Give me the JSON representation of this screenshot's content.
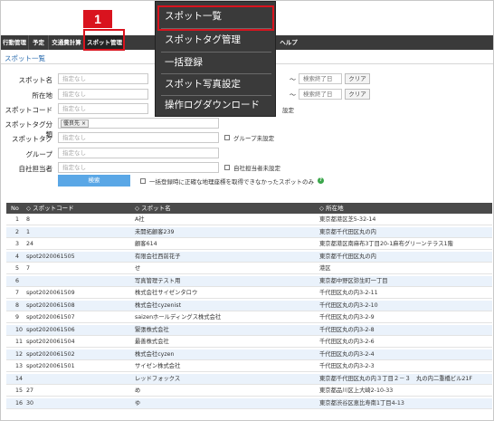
{
  "nav": {
    "items": [
      "行動管理",
      "予定",
      "交通費計算",
      "スポット管理",
      "",
      "ヘルプ"
    ]
  },
  "page_title": "スポット一覧",
  "form": {
    "spot_name_label": "スポット名",
    "address_label": "所在地",
    "spot_code_label": "スポットコード",
    "tag_category_label": "スポットタグ分類",
    "tag_label": "スポットタグ",
    "group_label": "グループ",
    "owner_label": "自社担当者",
    "placeholder": "指定なし",
    "tag_category_value": "優良先",
    "tag_close": "×",
    "date_end_placeholder": "検索終了日",
    "tilde": "〜",
    "clear_label": "クリア",
    "code_unset_label": "設定",
    "tag_unset_label": "グループ未設定",
    "owner_unset_label": "自社担当者未設定",
    "search_button": "検索",
    "geo_fail_label": "一括登録時に正確な地理座標を取得できなかったスポットのみ",
    "help_glyph": "?"
  },
  "table": {
    "headers": [
      "No",
      "スポットコード",
      "スポット名",
      "所在地"
    ],
    "rows": [
      [
        "1",
        "8",
        "A社",
        "東京都港区芝5-32-14"
      ],
      [
        "2",
        "1",
        "未開拓顧客239",
        "東京都千代田区丸の内"
      ],
      [
        "3",
        "24",
        "顧客614",
        "東京都港区南麻布3丁目20-1麻布グリーンテラス1階"
      ],
      [
        "4",
        "spot2020061505",
        "有限会社西前花子",
        "東京都千代田区丸の内"
      ],
      [
        "5",
        "7",
        "せ",
        "港区"
      ],
      [
        "6",
        "",
        "写真管理テスト用",
        "東京都中野区弥生町一丁目"
      ],
      [
        "7",
        "spot2020061509",
        "株式会社サイゼンタロウ",
        "千代田区丸の内3-2-11"
      ],
      [
        "8",
        "spot2020061508",
        "株式会社cyzenist",
        "千代田区丸の内3-2-10"
      ],
      [
        "9",
        "spot2020061507",
        "saizenホールディングス株式会社",
        "千代田区丸の内3-2-9"
      ],
      [
        "10",
        "spot2020061506",
        "緊張株式会社",
        "千代田区丸の内3-2-8"
      ],
      [
        "11",
        "spot2020061504",
        "最善株式会社",
        "千代田区丸の内3-2-6"
      ],
      [
        "12",
        "spot2020061502",
        "株式会社cyzen",
        "千代田区丸の内3-2-4"
      ],
      [
        "13",
        "spot2020061501",
        "サイゼン株式会社",
        "千代田区丸の内3-2-3"
      ],
      [
        "14",
        "",
        "レッドフォックス",
        "東京都千代田区丸の内３丁目２－３　丸の内二重橋ビル21F"
      ],
      [
        "15",
        "27",
        "め",
        "東京都品川区上大崎2-10-33"
      ],
      [
        "16",
        "30",
        "ゆ",
        "東京都渋谷区恵比寿南1丁目4-13"
      ]
    ]
  },
  "dropdown": {
    "items": [
      "スポット一覧",
      "スポットタグ管理",
      "一括登録",
      "スポット写真設定",
      "操作ログダウンロード"
    ]
  },
  "annotation": {
    "step": "1"
  },
  "colors": {
    "highlight": "#d9131e",
    "nav_bg": "#3a3a3a",
    "search_button": "#5aa7e6",
    "row_alt": "#eaf2fb"
  }
}
